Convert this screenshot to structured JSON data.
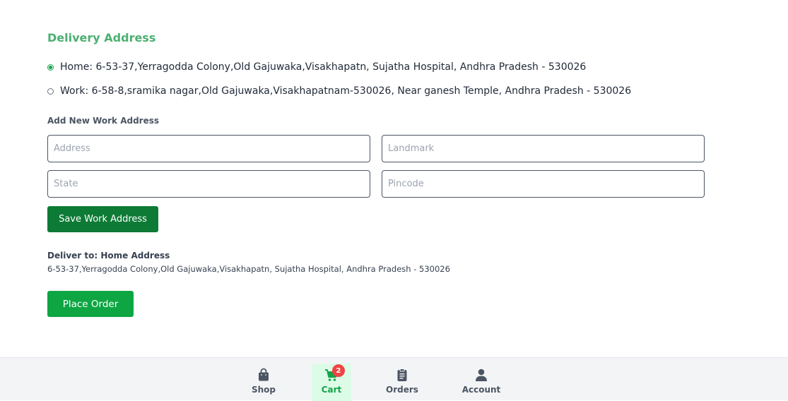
{
  "delivery": {
    "title": "Delivery Address",
    "options": [
      {
        "label": "Home: 6-53-37,Yerragodda Colony,Old Gajuwaka,Visakhapatn, Sujatha Hospital, Andhra Pradesh - 530026",
        "selected": true
      },
      {
        "label": "Work: 6-58-8,sramika nagar,Old Gajuwaka,Visakhapatnam-530026, Near ganesh Temple, Andhra Pradesh - 530026",
        "selected": false
      }
    ]
  },
  "new_address": {
    "heading": "Add New Work Address",
    "address": {
      "value": "",
      "placeholder": "Address"
    },
    "landmark": {
      "value": "",
      "placeholder": "Landmark"
    },
    "state": {
      "value": "",
      "placeholder": "State"
    },
    "pincode": {
      "value": "",
      "placeholder": "Pincode"
    },
    "save_label": "Save Work Address"
  },
  "deliver_to": {
    "title": "Deliver to: Home Address",
    "address": "6-53-37,Yerragodda Colony,Old Gajuwaka,Visakhapatn, Sujatha Hospital, Andhra Pradesh - 530026"
  },
  "place_order_label": "Place Order",
  "colors": {
    "accent": "#4caf72",
    "save_button": "#0d7a35",
    "order_button": "#0ea543",
    "badge": "#ef4444"
  },
  "bottom_nav": {
    "items": [
      {
        "label": "Shop",
        "icon": "shopping-bag-icon",
        "active": false
      },
      {
        "label": "Cart",
        "icon": "cart-icon",
        "active": true,
        "badge": "2"
      },
      {
        "label": "Orders",
        "icon": "clipboard-icon",
        "active": false
      },
      {
        "label": "Account",
        "icon": "user-icon",
        "active": false
      }
    ]
  }
}
